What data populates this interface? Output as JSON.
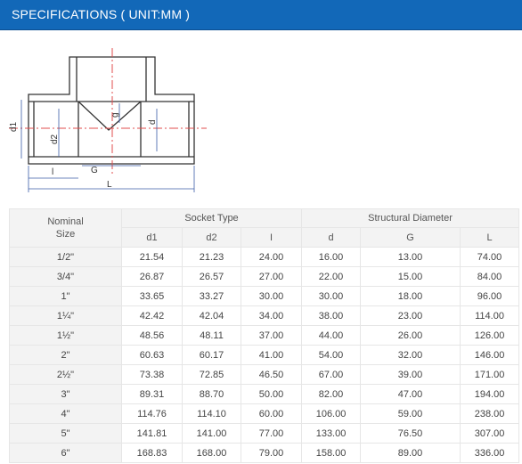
{
  "header": {
    "title": "SPECIFICATIONS ( UNIT:MM )"
  },
  "diagram": {
    "labels": {
      "d1": "d1",
      "d2": "d2",
      "d": "d",
      "g": "g",
      "l": "l",
      "G": "G",
      "L": "L"
    }
  },
  "table": {
    "groups": {
      "nominal": "Nominal Size",
      "socket": "Socket Type",
      "structural": "Structural Diameter"
    },
    "columns": [
      "d1",
      "d2",
      "I",
      "d",
      "G",
      "L"
    ],
    "rows": [
      [
        "1/2\"",
        "21.54",
        "21.23",
        "24.00",
        "16.00",
        "13.00",
        "74.00"
      ],
      [
        "3/4\"",
        "26.87",
        "26.57",
        "27.00",
        "22.00",
        "15.00",
        "84.00"
      ],
      [
        "1\"",
        "33.65",
        "33.27",
        "30.00",
        "30.00",
        "18.00",
        "96.00"
      ],
      [
        "1¼\"",
        "42.42",
        "42.04",
        "34.00",
        "38.00",
        "23.00",
        "114.00"
      ],
      [
        "1½\"",
        "48.56",
        "48.11",
        "37.00",
        "44.00",
        "26.00",
        "126.00"
      ],
      [
        "2\"",
        "60.63",
        "60.17",
        "41.00",
        "54.00",
        "32.00",
        "146.00"
      ],
      [
        "2½\"",
        "73.38",
        "72.85",
        "46.50",
        "67.00",
        "39.00",
        "171.00"
      ],
      [
        "3\"",
        "89.31",
        "88.70",
        "50.00",
        "82.00",
        "47.00",
        "194.00"
      ],
      [
        "4\"",
        "114.76",
        "114.10",
        "60.00",
        "106.00",
        "59.00",
        "238.00"
      ],
      [
        "5\"",
        "141.81",
        "141.00",
        "77.00",
        "133.00",
        "76.50",
        "307.00"
      ],
      [
        "6\"",
        "168.83",
        "168.00",
        "79.00",
        "158.00",
        "89.00",
        "336.00"
      ]
    ]
  }
}
